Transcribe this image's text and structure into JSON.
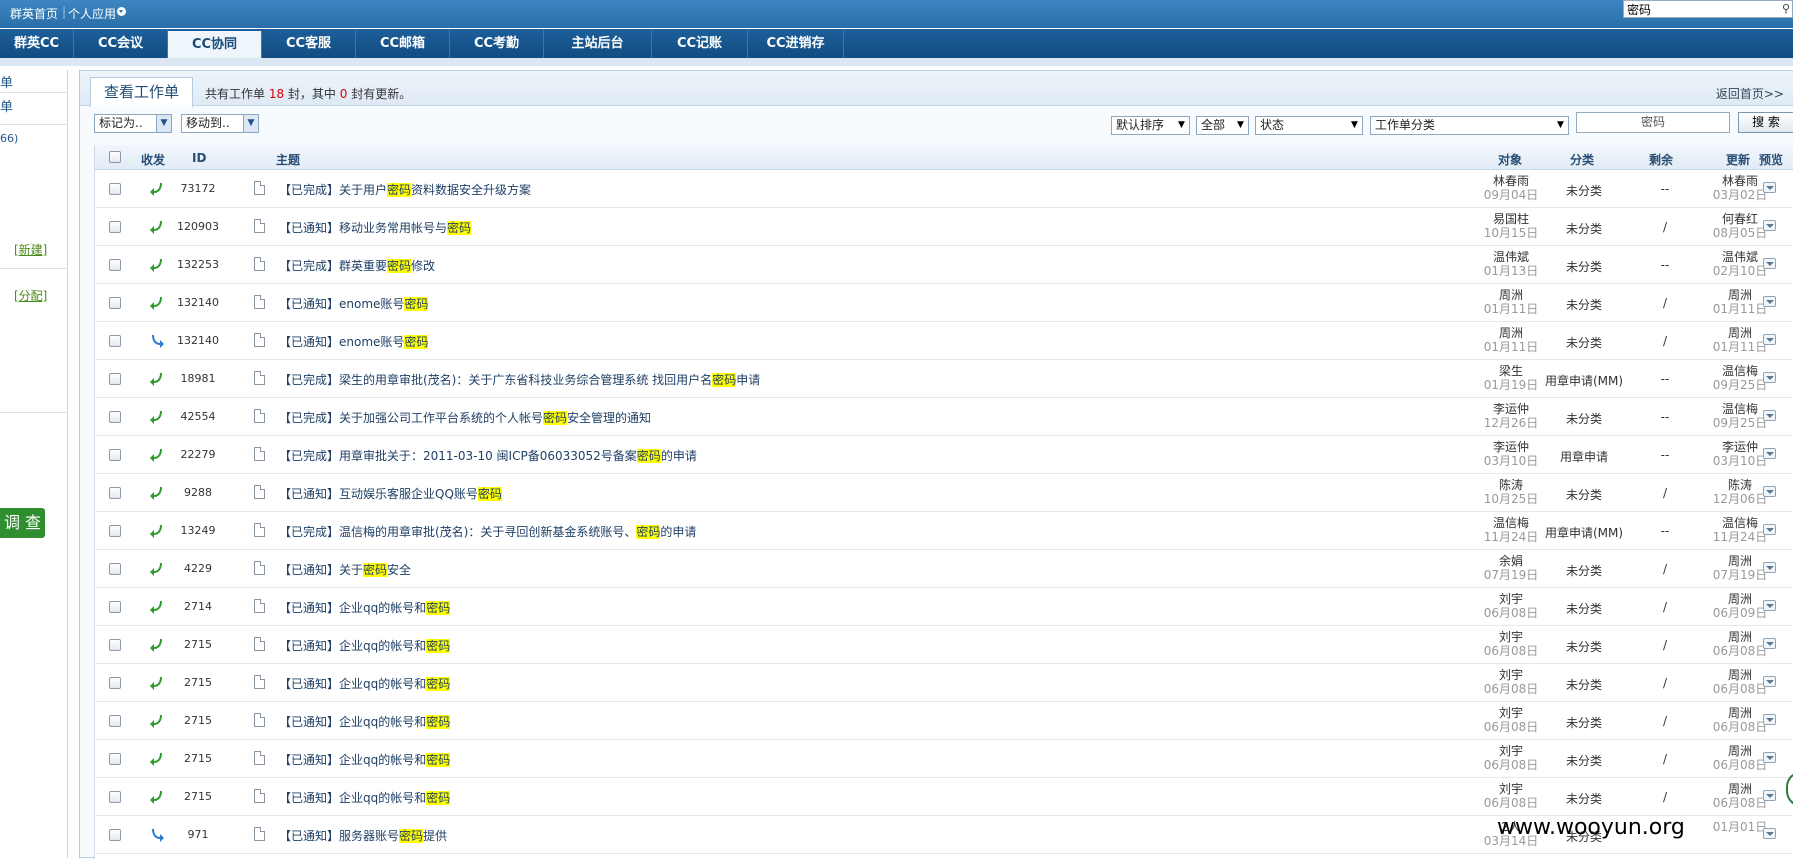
{
  "topbar": {
    "home_label": "群英首页",
    "apps_label": "个人应用",
    "search_value": "密码"
  },
  "nav": {
    "tabs": [
      {
        "label": "群英CC",
        "active": false
      },
      {
        "label": "CC会议",
        "active": false
      },
      {
        "label": "CC协同",
        "active": true
      },
      {
        "label": "CC客服",
        "active": false
      },
      {
        "label": "CC邮箱",
        "active": false
      },
      {
        "label": "CC考勤",
        "active": false
      },
      {
        "label": "主站后台",
        "active": false
      },
      {
        "label": "CC记账",
        "active": false
      },
      {
        "label": "CC进销存",
        "active": false
      }
    ]
  },
  "sidebar": {
    "item1": "单",
    "item2": "单",
    "count": "66)",
    "new_link": "[新建]",
    "assign_link": "[分配]",
    "survey_button": "调 查"
  },
  "main": {
    "title": "查看工作单",
    "summary_prefix": "共有工作单 ",
    "total": "18",
    "summary_mid": " 封，其中 ",
    "updated": "0",
    "summary_suffix": " 封有更新。",
    "back_link": "返回首页>>",
    "toolbar": {
      "mark_as": "标记为..",
      "move_to": "移动到..",
      "sort": "默认排序",
      "scope": "全部",
      "status": "状态",
      "category": "工作单分类",
      "keyword": "密码",
      "search_button": "搜 索"
    },
    "headers": {
      "direction": "收发",
      "id": "ID",
      "subject": "主题",
      "object": "对象",
      "category": "分类",
      "remaining": "剩余",
      "updated": "更新",
      "preview": "预览"
    },
    "rows": [
      {
        "dir": "in",
        "id": "73172",
        "pre": "【已完成】关于用户",
        "hl": "密码",
        "post": "资料数据安全升级方案",
        "obj": "林春雨",
        "obj_date": "09月04日",
        "cat": "未分类",
        "rem": "--",
        "upd": "林春雨",
        "upd_date": "03月02日"
      },
      {
        "dir": "in",
        "id": "120903",
        "pre": "【已通知】移动业务常用帐号与",
        "hl": "密码",
        "post": "",
        "obj": "易国柱",
        "obj_date": "10月15日",
        "cat": "未分类",
        "rem": "/",
        "upd": "何春红",
        "upd_date": "08月05日"
      },
      {
        "dir": "in",
        "id": "132253",
        "pre": "【已完成】群英重要",
        "hl": "密码",
        "post": "修改",
        "obj": "温伟斌",
        "obj_date": "01月13日",
        "cat": "未分类",
        "rem": "--",
        "upd": "温伟斌",
        "upd_date": "02月10日"
      },
      {
        "dir": "in",
        "id": "132140",
        "pre": "【已通知】enome账号",
        "hl": "密码",
        "post": "",
        "obj": "周洲",
        "obj_date": "01月11日",
        "cat": "未分类",
        "rem": "/",
        "upd": "周洲",
        "upd_date": "01月11日"
      },
      {
        "dir": "out",
        "id": "132140",
        "pre": "【已通知】enome账号",
        "hl": "密码",
        "post": "",
        "obj": "周洲",
        "obj_date": "01月11日",
        "cat": "未分类",
        "rem": "/",
        "upd": "周洲",
        "upd_date": "01月11日"
      },
      {
        "dir": "in",
        "id": "18981",
        "pre": "【已完成】梁生的用章审批(茂名)：关于广东省科技业务综合管理系统 找回用户名",
        "hl": "密码",
        "post": "申请",
        "obj": "梁生",
        "obj_date": "01月19日",
        "cat": "用章申请(MM)",
        "rem": "--",
        "upd": "温信梅",
        "upd_date": "09月25日"
      },
      {
        "dir": "in",
        "id": "42554",
        "pre": "【已完成】关于加强公司工作平台系统的个人帐号",
        "hl": "密码",
        "post": "安全管理的通知",
        "obj": "李运仲",
        "obj_date": "12月26日",
        "cat": "未分类",
        "rem": "--",
        "upd": "温信梅",
        "upd_date": "09月25日"
      },
      {
        "dir": "in",
        "id": "22279",
        "pre": "【已完成】用章审批关于：2011-03-10 闽ICP备06033052号备案",
        "hl": "密码",
        "post": "的申请",
        "obj": "李运仲",
        "obj_date": "03月10日",
        "cat": "用章申请",
        "rem": "--",
        "upd": "李运仲",
        "upd_date": "03月10日"
      },
      {
        "dir": "in",
        "id": "9288",
        "pre": "【已通知】互动娱乐客服企业QQ账号",
        "hl": "密码",
        "post": "",
        "obj": "陈涛",
        "obj_date": "10月25日",
        "cat": "未分类",
        "rem": "/",
        "upd": "陈涛",
        "upd_date": "12月06日"
      },
      {
        "dir": "in",
        "id": "13249",
        "pre": "【已完成】温信梅的用章审批(茂名)：关于寻回创新基金系统账号、",
        "hl": "密码",
        "post": "的申请",
        "obj": "温信梅",
        "obj_date": "11月24日",
        "cat": "用章申请(MM)",
        "rem": "--",
        "upd": "温信梅",
        "upd_date": "11月24日"
      },
      {
        "dir": "in",
        "id": "4229",
        "pre": "【已通知】关于",
        "hl": "密码",
        "post": "安全",
        "obj": "余娟",
        "obj_date": "07月19日",
        "cat": "未分类",
        "rem": "/",
        "upd": "周洲",
        "upd_date": "07月19日"
      },
      {
        "dir": "in",
        "id": "2714",
        "pre": "【已通知】企业qq的帐号和",
        "hl": "密码",
        "post": "",
        "obj": "刘宇",
        "obj_date": "06月08日",
        "cat": "未分类",
        "rem": "/",
        "upd": "周洲",
        "upd_date": "06月09日"
      },
      {
        "dir": "in",
        "id": "2715",
        "pre": "【已通知】企业qq的帐号和",
        "hl": "密码",
        "post": "",
        "obj": "刘宇",
        "obj_date": "06月08日",
        "cat": "未分类",
        "rem": "/",
        "upd": "周洲",
        "upd_date": "06月08日"
      },
      {
        "dir": "in",
        "id": "2715",
        "pre": "【已通知】企业qq的帐号和",
        "hl": "密码",
        "post": "",
        "obj": "刘宇",
        "obj_date": "06月08日",
        "cat": "未分类",
        "rem": "/",
        "upd": "周洲",
        "upd_date": "06月08日"
      },
      {
        "dir": "in",
        "id": "2715",
        "pre": "【已通知】企业qq的帐号和",
        "hl": "密码",
        "post": "",
        "obj": "刘宇",
        "obj_date": "06月08日",
        "cat": "未分类",
        "rem": "/",
        "upd": "周洲",
        "upd_date": "06月08日"
      },
      {
        "dir": "in",
        "id": "2715",
        "pre": "【已通知】企业qq的帐号和",
        "hl": "密码",
        "post": "",
        "obj": "刘宇",
        "obj_date": "06月08日",
        "cat": "未分类",
        "rem": "/",
        "upd": "周洲",
        "upd_date": "06月08日"
      },
      {
        "dir": "in",
        "id": "2715",
        "pre": "【已通知】企业qq的帐号和",
        "hl": "密码",
        "post": "",
        "obj": "刘宇",
        "obj_date": "06月08日",
        "cat": "未分类",
        "rem": "/",
        "upd": "周洲",
        "upd_date": "06月08日"
      },
      {
        "dir": "out",
        "id": "971",
        "pre": "【已通知】服务器账号",
        "hl": "密码",
        "post": "提供",
        "obj": "2人",
        "obj_date": "03月14日",
        "cat": "未分类",
        "rem": "",
        "upd": "",
        "upd_date": "01月01日"
      }
    ]
  },
  "watermark": "www.wooyun.org"
}
